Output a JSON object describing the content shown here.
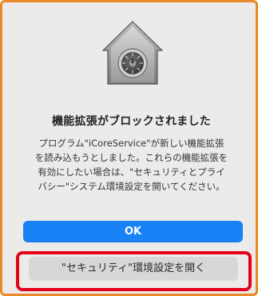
{
  "dialog": {
    "icon": "security-lock-icon",
    "title": "機能拡張がブロックされました",
    "message_lines": [
      "プログラム\"iCoreService\"が新しい機能拡張",
      "を読み込もうとしました。これらの機能拡張を",
      "有効にしたい場合は、\"セキュリティとプライ",
      "バシー\"システム環境設定を開いてください。"
    ],
    "ok_label": "OK",
    "open_settings_label": "\"セキュリティ\"環境設定を開く"
  },
  "colors": {
    "dialog_background": "#ecebea",
    "border_accent": "#e88a2a",
    "primary_button": "#1a82f7",
    "highlight": "#e3001b"
  }
}
